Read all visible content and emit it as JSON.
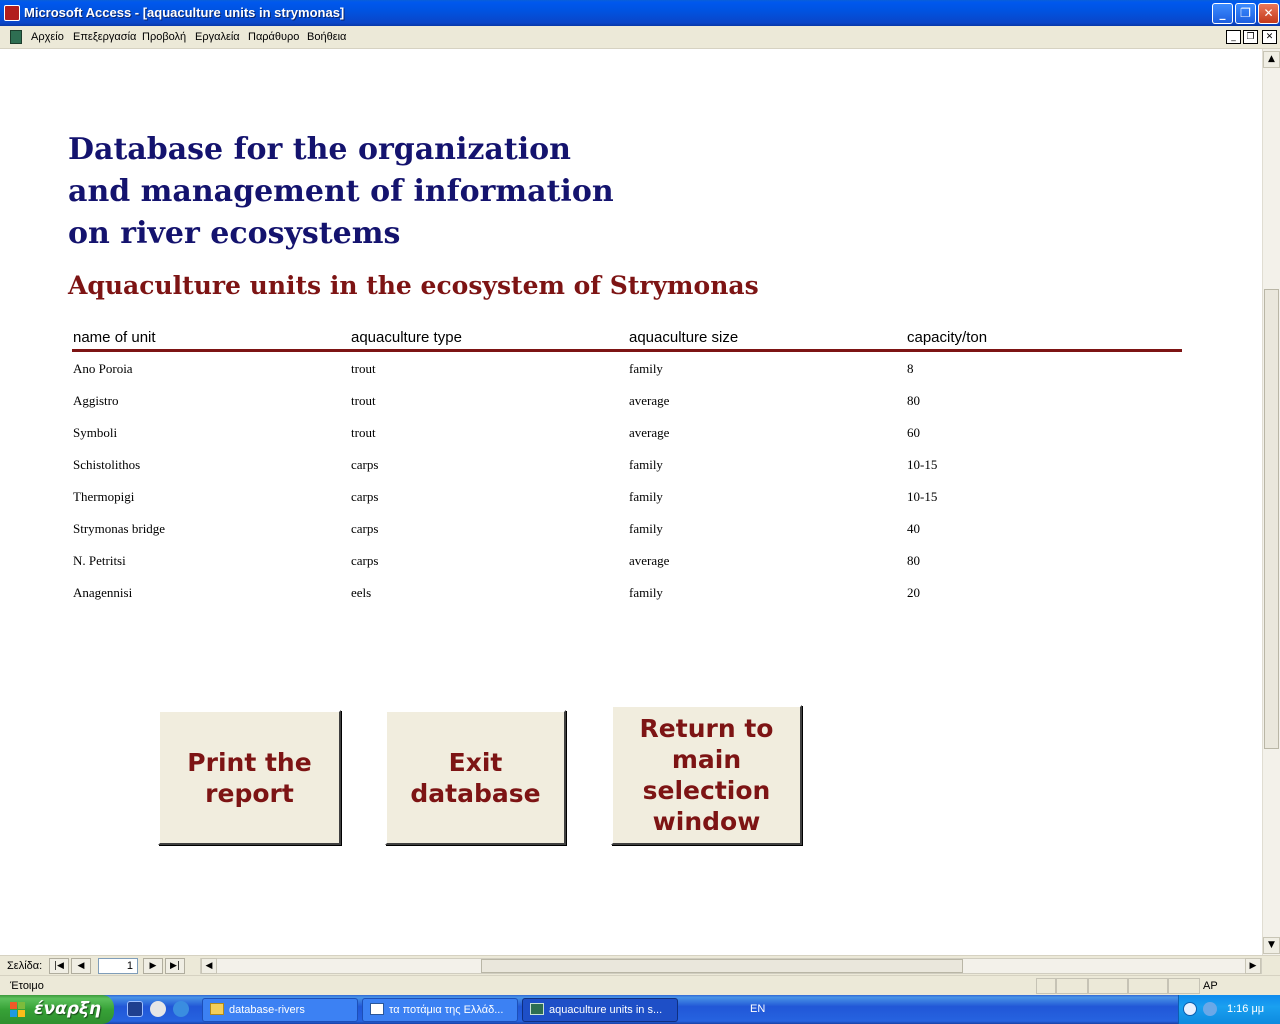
{
  "window": {
    "title": "Microsoft Access - [aquaculture units in strymonas]",
    "minimize": "_",
    "restore": "❐",
    "close": "✕"
  },
  "menu": {
    "items": [
      "Αρχείο",
      "Επεξεργασία",
      "Προβολή",
      "Εργαλεία",
      "Παράθυρο",
      "Βοήθεια"
    ],
    "mdi_minimize": "_",
    "mdi_restore": "❐",
    "mdi_close": "✕"
  },
  "report": {
    "heading_lines": [
      "Database for the organization",
      "and management of information",
      "on river ecosystems"
    ],
    "subheading": "Aquaculture units in the ecosystem of Strymonas",
    "columns": [
      "name of unit",
      "aquaculture  type",
      "aquaculture size",
      "capacity/ton"
    ],
    "rows": [
      [
        "Ano Poroia",
        "trout",
        "family",
        "8"
      ],
      [
        "Aggistro",
        "trout",
        "average",
        "80"
      ],
      [
        "Symboli",
        "trout",
        "average",
        "60"
      ],
      [
        "Schistolithos",
        "carps",
        "family",
        "10-15"
      ],
      [
        "Thermopigi",
        "carps",
        "family",
        "10-15"
      ],
      [
        "Strymonas bridge",
        "carps",
        "family",
        "40"
      ],
      [
        "N. Petritsi",
        "carps",
        "average",
        "80"
      ],
      [
        "Anagennisi",
        "eels",
        "family",
        "20"
      ]
    ],
    "buttons": {
      "print": "Print the report",
      "exit": "Exit database",
      "return": "Return to main selection window"
    },
    "accent_color": "#7d1414",
    "heading_color": "#14136e"
  },
  "navigation": {
    "label": "Σελίδα:",
    "page_value": "1",
    "first": "|◀",
    "prev": "◀",
    "next": "▶",
    "last": "▶|"
  },
  "status": {
    "text": "Έτοιμο",
    "indicator": "AP"
  },
  "taskbar": {
    "start_label": "έναρξη",
    "tasks": [
      {
        "label": "database-rivers",
        "icon": "folder-icon"
      },
      {
        "label": "τα ποτάμια της Ελλάδ...",
        "icon": "word-document-icon"
      },
      {
        "label": "aquaculture units in s...",
        "icon": "access-report-icon"
      }
    ],
    "language": "EN",
    "clock": "1:16 μμ"
  }
}
